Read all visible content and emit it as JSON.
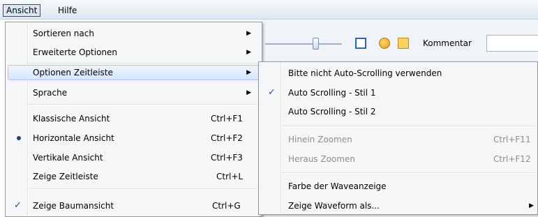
{
  "menubar": {
    "items": [
      {
        "label": "Ansicht"
      },
      {
        "label": "Hilfe"
      }
    ]
  },
  "toolbar": {
    "kommentar_label": "Kommentar",
    "kommentar_value": ""
  },
  "main_menu": {
    "items": [
      {
        "label": "Sortieren nach",
        "submenu": true
      },
      {
        "label": "Erweiterte Optionen",
        "submenu": true
      },
      {
        "label": "Optionen Zeitleiste",
        "submenu": true
      },
      {
        "label": "Sprache",
        "submenu": true
      },
      {
        "label": "Klassische Ansicht",
        "shortcut": "Ctrl+F1"
      },
      {
        "label": "Horizontale Ansicht",
        "shortcut": "Ctrl+F2",
        "radio": true
      },
      {
        "label": "Vertikale Ansicht",
        "shortcut": "Ctrl+F3"
      },
      {
        "label": "Zeige Zeitleiste",
        "shortcut": "Ctrl+L"
      },
      {
        "label": "Zeige Baumansicht",
        "shortcut": "Ctrl+G",
        "checked": true
      }
    ]
  },
  "sub_menu": {
    "items": [
      {
        "label": "Bitte nicht Auto-Scrolling verwenden"
      },
      {
        "label": "Auto Scrolling - Stil 1",
        "checked": true
      },
      {
        "label": "Auto Scrolling - Stil 2"
      },
      {
        "label": "Hinein Zoomen",
        "shortcut": "Ctrl+F11",
        "disabled": true
      },
      {
        "label": "Heraus Zoomen",
        "shortcut": "Ctrl+F12",
        "disabled": true
      },
      {
        "label": "Farbe der Waveanzeige"
      },
      {
        "label": "Zeige Waveform als...",
        "submenu": true
      }
    ]
  },
  "glyphs": {
    "arrow": "▶",
    "check": "✓"
  },
  "colors": {
    "highlight": "#d6e6fa",
    "check": "#1f4f91",
    "disabled": "#8d8d8d"
  }
}
